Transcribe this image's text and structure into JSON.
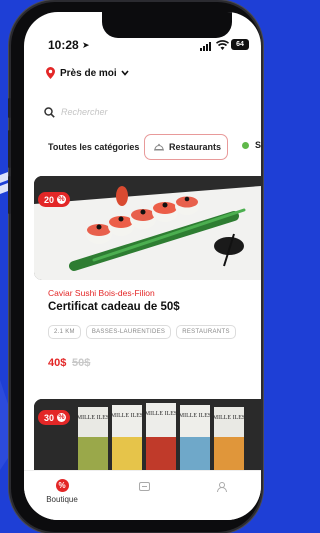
{
  "status_bar": {
    "time": "10:28",
    "battery": "64"
  },
  "location": {
    "label": "Près de moi"
  },
  "search": {
    "placeholder": "Rechercher"
  },
  "categories": {
    "all_label": "Toutes les catégories",
    "selected_label": "Restaurants",
    "next_label": "S"
  },
  "offers": [
    {
      "discount": "20",
      "merchant": "Caviar Sushi Bois-des-Filion",
      "title": "Certificat cadeau de 50$",
      "tags": [
        "2.1 KM",
        "BASSES-LAURENTIDES",
        "RESTAURANTS"
      ],
      "price": "40$",
      "old_price": "50$"
    },
    {
      "discount": "30",
      "can_brand": "MILLE ILES"
    }
  ],
  "tab_bar": {
    "home_label": "Boutique"
  },
  "colors": {
    "accent": "#e32727",
    "background": "#1e3fd6",
    "chip_border": "#e89a9a"
  }
}
